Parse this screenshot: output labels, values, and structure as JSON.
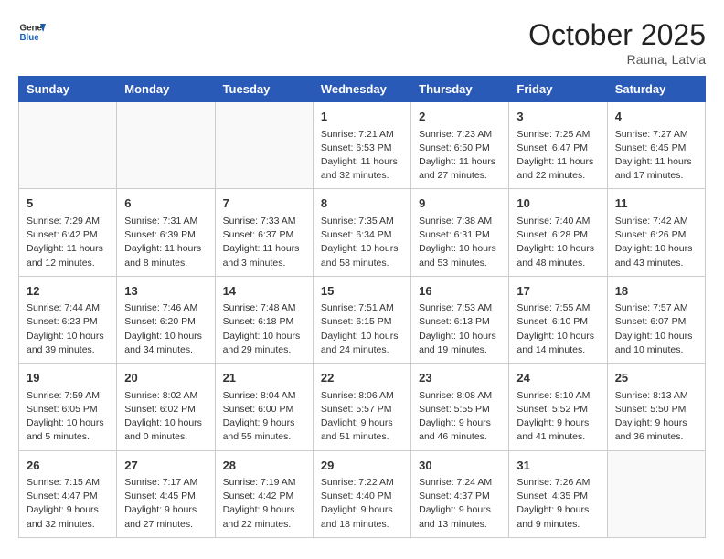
{
  "header": {
    "logo_general": "General",
    "logo_blue": "Blue",
    "month": "October 2025",
    "location": "Rauna, Latvia"
  },
  "weekdays": [
    "Sunday",
    "Monday",
    "Tuesday",
    "Wednesday",
    "Thursday",
    "Friday",
    "Saturday"
  ],
  "weeks": [
    [
      {
        "day": "",
        "sunrise": "",
        "sunset": "",
        "daylight": ""
      },
      {
        "day": "",
        "sunrise": "",
        "sunset": "",
        "daylight": ""
      },
      {
        "day": "",
        "sunrise": "",
        "sunset": "",
        "daylight": ""
      },
      {
        "day": "1",
        "sunrise": "Sunrise: 7:21 AM",
        "sunset": "Sunset: 6:53 PM",
        "daylight": "Daylight: 11 hours and 32 minutes."
      },
      {
        "day": "2",
        "sunrise": "Sunrise: 7:23 AM",
        "sunset": "Sunset: 6:50 PM",
        "daylight": "Daylight: 11 hours and 27 minutes."
      },
      {
        "day": "3",
        "sunrise": "Sunrise: 7:25 AM",
        "sunset": "Sunset: 6:47 PM",
        "daylight": "Daylight: 11 hours and 22 minutes."
      },
      {
        "day": "4",
        "sunrise": "Sunrise: 7:27 AM",
        "sunset": "Sunset: 6:45 PM",
        "daylight": "Daylight: 11 hours and 17 minutes."
      }
    ],
    [
      {
        "day": "5",
        "sunrise": "Sunrise: 7:29 AM",
        "sunset": "Sunset: 6:42 PM",
        "daylight": "Daylight: 11 hours and 12 minutes."
      },
      {
        "day": "6",
        "sunrise": "Sunrise: 7:31 AM",
        "sunset": "Sunset: 6:39 PM",
        "daylight": "Daylight: 11 hours and 8 minutes."
      },
      {
        "day": "7",
        "sunrise": "Sunrise: 7:33 AM",
        "sunset": "Sunset: 6:37 PM",
        "daylight": "Daylight: 11 hours and 3 minutes."
      },
      {
        "day": "8",
        "sunrise": "Sunrise: 7:35 AM",
        "sunset": "Sunset: 6:34 PM",
        "daylight": "Daylight: 10 hours and 58 minutes."
      },
      {
        "day": "9",
        "sunrise": "Sunrise: 7:38 AM",
        "sunset": "Sunset: 6:31 PM",
        "daylight": "Daylight: 10 hours and 53 minutes."
      },
      {
        "day": "10",
        "sunrise": "Sunrise: 7:40 AM",
        "sunset": "Sunset: 6:28 PM",
        "daylight": "Daylight: 10 hours and 48 minutes."
      },
      {
        "day": "11",
        "sunrise": "Sunrise: 7:42 AM",
        "sunset": "Sunset: 6:26 PM",
        "daylight": "Daylight: 10 hours and 43 minutes."
      }
    ],
    [
      {
        "day": "12",
        "sunrise": "Sunrise: 7:44 AM",
        "sunset": "Sunset: 6:23 PM",
        "daylight": "Daylight: 10 hours and 39 minutes."
      },
      {
        "day": "13",
        "sunrise": "Sunrise: 7:46 AM",
        "sunset": "Sunset: 6:20 PM",
        "daylight": "Daylight: 10 hours and 34 minutes."
      },
      {
        "day": "14",
        "sunrise": "Sunrise: 7:48 AM",
        "sunset": "Sunset: 6:18 PM",
        "daylight": "Daylight: 10 hours and 29 minutes."
      },
      {
        "day": "15",
        "sunrise": "Sunrise: 7:51 AM",
        "sunset": "Sunset: 6:15 PM",
        "daylight": "Daylight: 10 hours and 24 minutes."
      },
      {
        "day": "16",
        "sunrise": "Sunrise: 7:53 AM",
        "sunset": "Sunset: 6:13 PM",
        "daylight": "Daylight: 10 hours and 19 minutes."
      },
      {
        "day": "17",
        "sunrise": "Sunrise: 7:55 AM",
        "sunset": "Sunset: 6:10 PM",
        "daylight": "Daylight: 10 hours and 14 minutes."
      },
      {
        "day": "18",
        "sunrise": "Sunrise: 7:57 AM",
        "sunset": "Sunset: 6:07 PM",
        "daylight": "Daylight: 10 hours and 10 minutes."
      }
    ],
    [
      {
        "day": "19",
        "sunrise": "Sunrise: 7:59 AM",
        "sunset": "Sunset: 6:05 PM",
        "daylight": "Daylight: 10 hours and 5 minutes."
      },
      {
        "day": "20",
        "sunrise": "Sunrise: 8:02 AM",
        "sunset": "Sunset: 6:02 PM",
        "daylight": "Daylight: 10 hours and 0 minutes."
      },
      {
        "day": "21",
        "sunrise": "Sunrise: 8:04 AM",
        "sunset": "Sunset: 6:00 PM",
        "daylight": "Daylight: 9 hours and 55 minutes."
      },
      {
        "day": "22",
        "sunrise": "Sunrise: 8:06 AM",
        "sunset": "Sunset: 5:57 PM",
        "daylight": "Daylight: 9 hours and 51 minutes."
      },
      {
        "day": "23",
        "sunrise": "Sunrise: 8:08 AM",
        "sunset": "Sunset: 5:55 PM",
        "daylight": "Daylight: 9 hours and 46 minutes."
      },
      {
        "day": "24",
        "sunrise": "Sunrise: 8:10 AM",
        "sunset": "Sunset: 5:52 PM",
        "daylight": "Daylight: 9 hours and 41 minutes."
      },
      {
        "day": "25",
        "sunrise": "Sunrise: 8:13 AM",
        "sunset": "Sunset: 5:50 PM",
        "daylight": "Daylight: 9 hours and 36 minutes."
      }
    ],
    [
      {
        "day": "26",
        "sunrise": "Sunrise: 7:15 AM",
        "sunset": "Sunset: 4:47 PM",
        "daylight": "Daylight: 9 hours and 32 minutes."
      },
      {
        "day": "27",
        "sunrise": "Sunrise: 7:17 AM",
        "sunset": "Sunset: 4:45 PM",
        "daylight": "Daylight: 9 hours and 27 minutes."
      },
      {
        "day": "28",
        "sunrise": "Sunrise: 7:19 AM",
        "sunset": "Sunset: 4:42 PM",
        "daylight": "Daylight: 9 hours and 22 minutes."
      },
      {
        "day": "29",
        "sunrise": "Sunrise: 7:22 AM",
        "sunset": "Sunset: 4:40 PM",
        "daylight": "Daylight: 9 hours and 18 minutes."
      },
      {
        "day": "30",
        "sunrise": "Sunrise: 7:24 AM",
        "sunset": "Sunset: 4:37 PM",
        "daylight": "Daylight: 9 hours and 13 minutes."
      },
      {
        "day": "31",
        "sunrise": "Sunrise: 7:26 AM",
        "sunset": "Sunset: 4:35 PM",
        "daylight": "Daylight: 9 hours and 9 minutes."
      },
      {
        "day": "",
        "sunrise": "",
        "sunset": "",
        "daylight": ""
      }
    ]
  ]
}
